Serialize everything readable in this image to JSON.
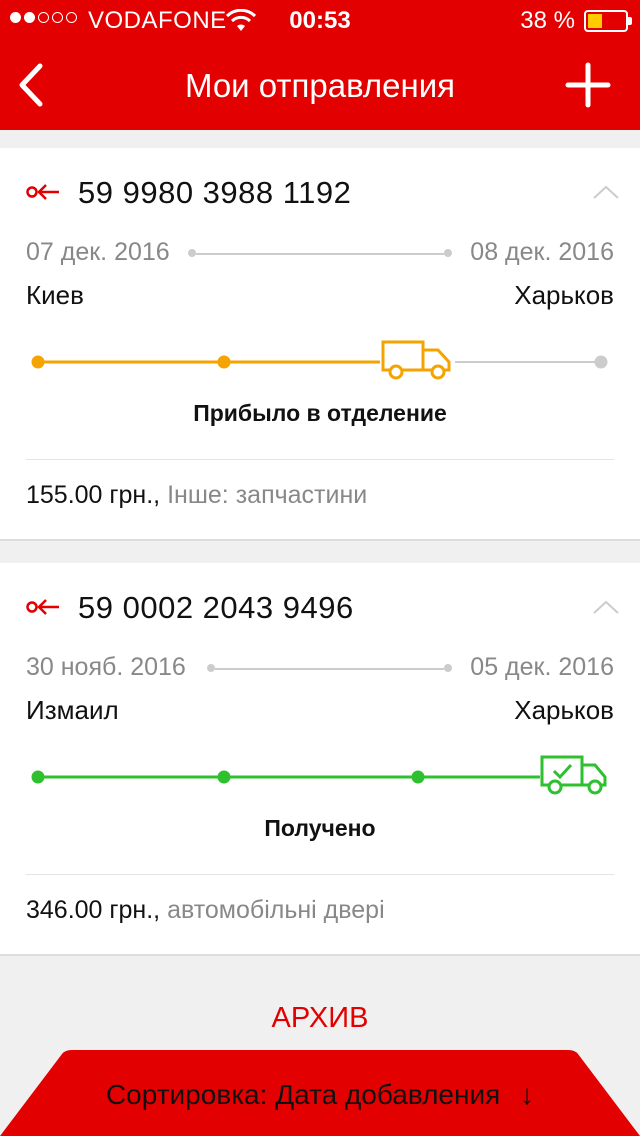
{
  "statusbar": {
    "carrier": "VODAFONE",
    "time": "00:53",
    "battery": "38 %",
    "signal_bars": 2,
    "battery_level": 0.38
  },
  "navbar": {
    "title": "Мои отправления"
  },
  "shipments": [
    {
      "number": "59 9980 3988 1192",
      "date_from": "07 дек. 2016",
      "date_to": "08 дек. 2016",
      "city_from": "Киев",
      "city_to": "Харьков",
      "status": "Прибыло в отделение",
      "price": "155.00 грн.,",
      "description": "Інше: запчастини",
      "progress_color": "#f5a300",
      "progress_step": 3
    },
    {
      "number": "59 0002 2043 9496",
      "date_from": "30 нояб. 2016",
      "date_to": "05 дек. 2016",
      "city_from": "Измаил",
      "city_to": "Харьков",
      "status": "Получено",
      "price": "346.00 грн.,",
      "description": "автомобільні двері",
      "progress_color": "#2ec02e",
      "progress_step": 4
    }
  ],
  "archive_label": "АРХИВ",
  "sort": {
    "label": "Сортировка:",
    "value": "Дата добавления",
    "arrow": "↓"
  },
  "colors": {
    "accent": "#e20000",
    "inactive": "#cccccc"
  }
}
